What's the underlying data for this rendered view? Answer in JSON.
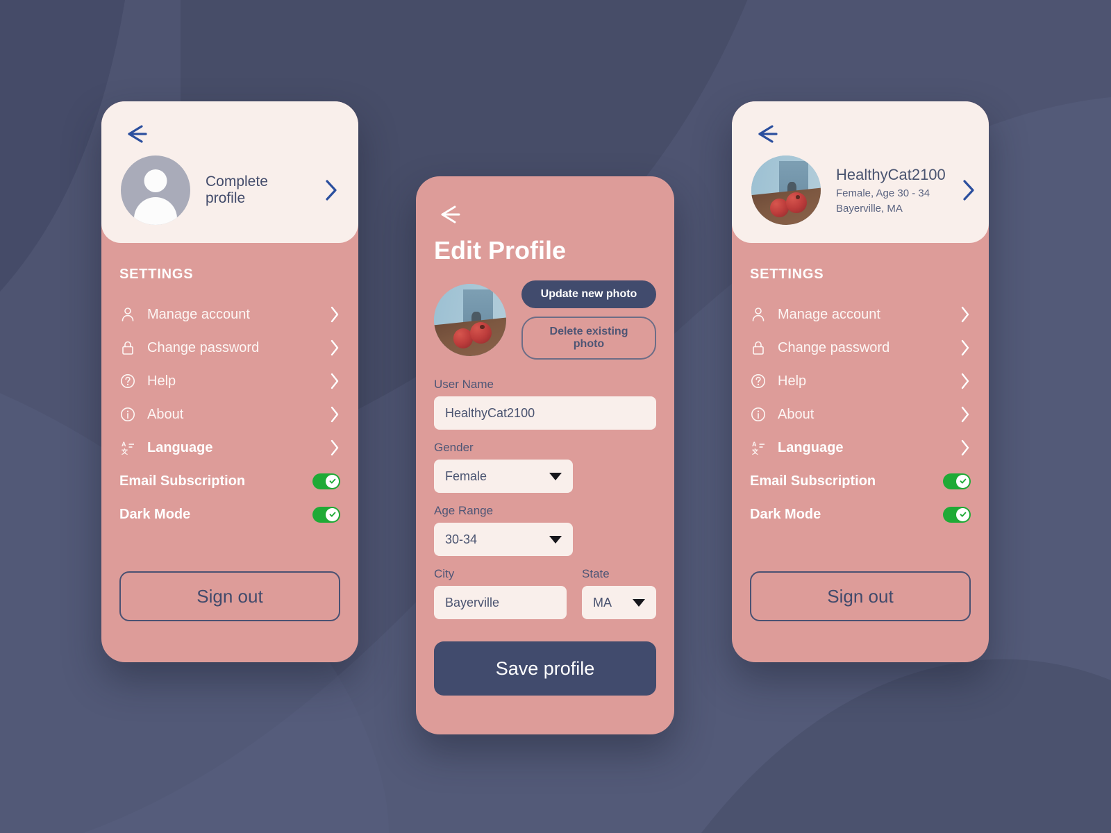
{
  "theme": {
    "background": "#4e5471",
    "panel_pink": "#dd9c99",
    "panel_cream": "#f9efeb",
    "navy": "#414b6d",
    "toggle_green": "#1faa36",
    "back_arrow_blue": "#2b4f9e"
  },
  "panel_profile_incomplete": {
    "back_icon": "back-arrow-icon",
    "avatar_icon": "default-user-avatar-icon",
    "complete_label": "Complete profile",
    "chevron_icon": "chevron-right-icon",
    "section_title": "SETTINGS",
    "items": [
      {
        "label": "Manage account",
        "icon": "user-icon"
      },
      {
        "label": "Change password",
        "icon": "lock-icon"
      },
      {
        "label": "Help",
        "icon": "question-circle-icon"
      },
      {
        "label": "About",
        "icon": "info-circle-icon"
      },
      {
        "label": "Language",
        "icon": "translate-icon"
      }
    ],
    "toggles": [
      {
        "label": "Email Subscription",
        "state": "on"
      },
      {
        "label": "Dark Mode",
        "state": "on"
      }
    ],
    "signout_label": "Sign out"
  },
  "panel_edit_profile": {
    "back_icon": "back-arrow-icon",
    "title": "Edit Profile",
    "avatar_icon": "user-photo-pomegranates",
    "update_photo_label": "Update new photo",
    "delete_photo_label": "Delete existing photo",
    "fields": {
      "username_label": "User Name",
      "username_value": "HealthyCat2100",
      "gender_label": "Gender",
      "gender_value": "Female",
      "age_label": "Age Range",
      "age_value": "30-34",
      "city_label": "City",
      "city_value": "Bayerville",
      "state_label": "State",
      "state_value": "MA"
    },
    "save_label": "Save profile"
  },
  "panel_profile_complete": {
    "back_icon": "back-arrow-icon",
    "avatar_icon": "user-photo-pomegranates",
    "user_name": "HealthyCat2100",
    "user_demographics": "Female, Age 30 - 34",
    "user_location": "Bayerville, MA",
    "chevron_icon": "chevron-right-icon",
    "section_title": "SETTINGS",
    "items": [
      {
        "label": "Manage account",
        "icon": "user-icon"
      },
      {
        "label": "Change password",
        "icon": "lock-icon"
      },
      {
        "label": "Help",
        "icon": "question-circle-icon"
      },
      {
        "label": "About",
        "icon": "info-circle-icon"
      },
      {
        "label": "Language",
        "icon": "translate-icon"
      }
    ],
    "toggles": [
      {
        "label": "Email Subscription",
        "state": "on"
      },
      {
        "label": "Dark Mode",
        "state": "on"
      }
    ],
    "signout_label": "Sign out"
  }
}
